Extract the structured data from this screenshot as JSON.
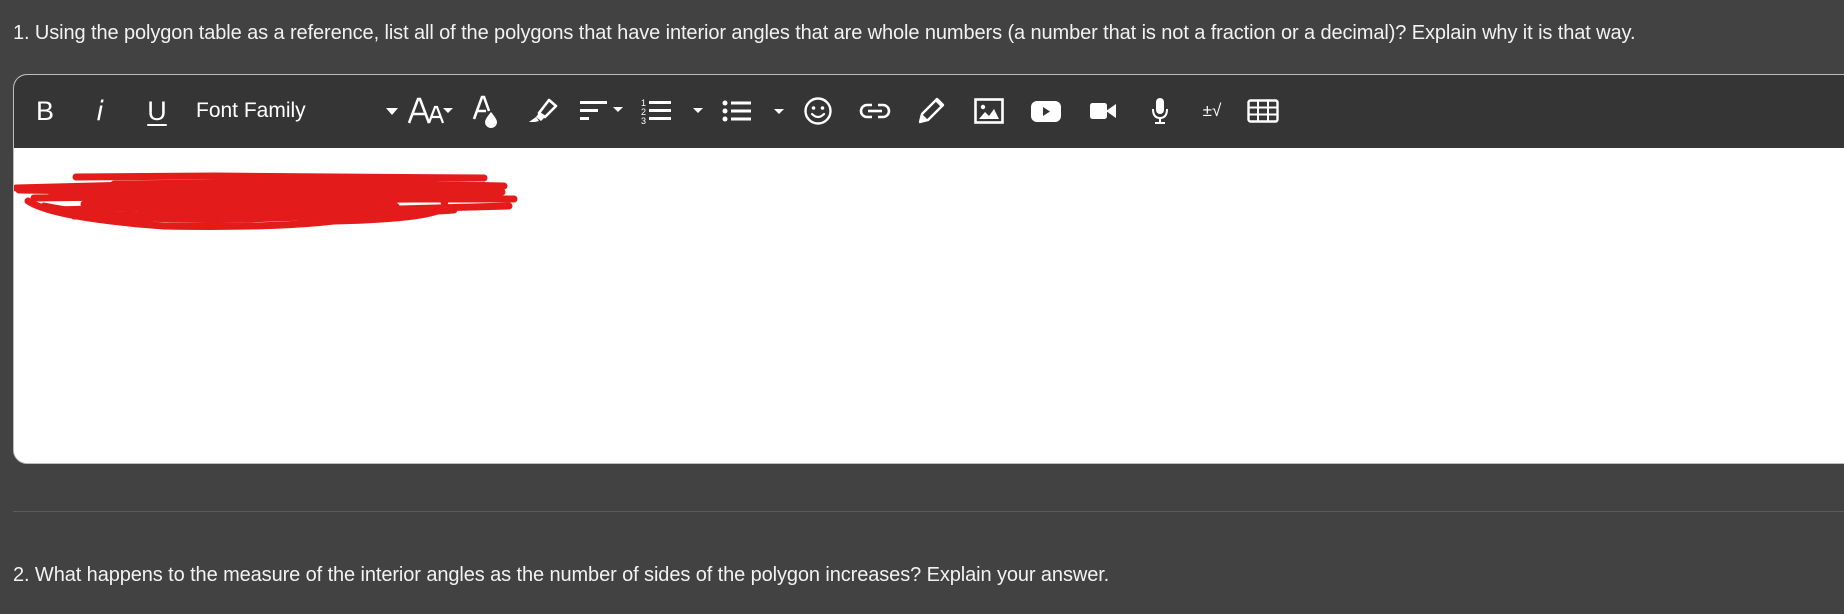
{
  "questions": [
    {
      "number": "1.",
      "text": "1. Using the polygon table as a reference, list all of the polygons that have interior angles that are whole numbers (a number that is not a fraction or a decimal)? Explain why it is that way."
    },
    {
      "number": "2.",
      "text": "2. What happens to the measure of the interior angles as the number of sides of the polygon increases? Explain your answer."
    }
  ],
  "toolbar": {
    "bold_label": "B",
    "italic_label": "i",
    "underline_label": "U",
    "font_family_label": "Font Family",
    "math_label": "±√",
    "icons": [
      "bold-icon",
      "italic-icon",
      "underline-icon",
      "font-family-dropdown",
      "font-size-icon",
      "font-color-icon",
      "highlight-icon",
      "align-icon",
      "numbered-list-icon",
      "bullet-list-icon",
      "emoji-icon",
      "link-icon",
      "draw-icon",
      "image-icon",
      "youtube-icon",
      "video-icon",
      "microphone-icon",
      "math-icon",
      "table-icon"
    ]
  },
  "editor": {
    "content": "",
    "redacted": true,
    "redaction_color": "#e31b1b"
  },
  "colors": {
    "page_bg": "#424242",
    "toolbar_bg": "#353535",
    "editor_bg": "#ffffff",
    "text": "#f2f2f2"
  }
}
